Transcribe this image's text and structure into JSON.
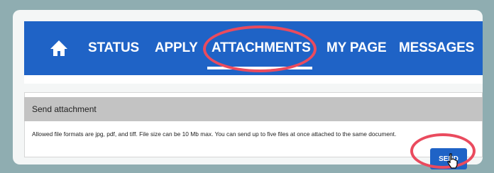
{
  "nav": {
    "items": [
      "STATUS",
      "APPLY",
      "ATTACHMENTS",
      "MY PAGE",
      "MESSAGES"
    ],
    "active": "ATTACHMENTS",
    "home_icon": "home-icon"
  },
  "card": {
    "title": "Send attachment",
    "text": "Allowed file formats are jpg, pdf, and tiff. File size can be 10 Mb max. You can send up to five files at once attached to the same document.",
    "send_label": "SEND"
  },
  "colors": {
    "brand": "#1f63c6",
    "highlight": "#ea4b5e",
    "header": "#c3c3c3"
  }
}
